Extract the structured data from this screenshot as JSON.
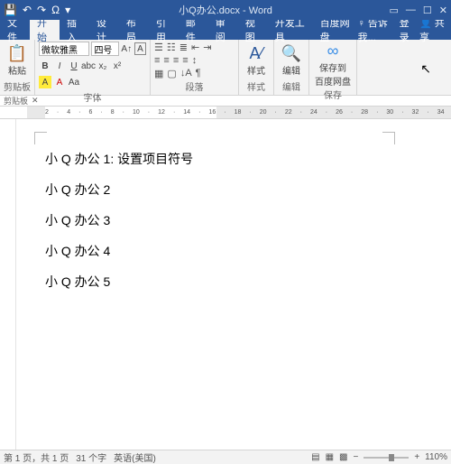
{
  "titlebar": {
    "title": "小Q办公.docx - Word",
    "qat_save": "💾",
    "qat_undo": "↶",
    "qat_redo": "↷",
    "qat_misc": "Ω",
    "qat_more": "▾"
  },
  "wincontrols": {
    "min": "—",
    "max": "☐",
    "close": "✕",
    "ribbon_opts": "▭"
  },
  "tabs": {
    "file": "文件",
    "home": "开始",
    "insert": "插入",
    "design": "设计",
    "layout": "布局",
    "references": "引用",
    "mailings": "邮件",
    "review": "审阅",
    "view": "视图",
    "dev": "开发工具",
    "baidu": "百度网盘",
    "tell_me": "告诉我...",
    "signin": "登录",
    "share": "共享"
  },
  "ribbon": {
    "clipboard": {
      "label": "剪贴板",
      "paste": "粘贴"
    },
    "font": {
      "label": "字体",
      "name": "微软雅黑",
      "size": "四号",
      "aplus": "A",
      "boxA": "A"
    },
    "paragraph": {
      "label": "段落"
    },
    "styles": {
      "label": "样式",
      "btn": "样式"
    },
    "editing": {
      "label": "编辑",
      "btn": "编辑"
    },
    "save": {
      "label": "保存",
      "btn1": "保存到",
      "btn2": "百度网盘"
    }
  },
  "document": {
    "lines": [
      "小 Q 办公 1:    设置项目符号",
      "小 Q 办公 2",
      "小 Q 办公 3",
      "小 Q 办公 4",
      "小 Q 办公 5"
    ]
  },
  "status": {
    "page": "第 1 页，共 1 页",
    "words": "31 个字",
    "lang": "英语(美国)",
    "zoom": "110%"
  }
}
